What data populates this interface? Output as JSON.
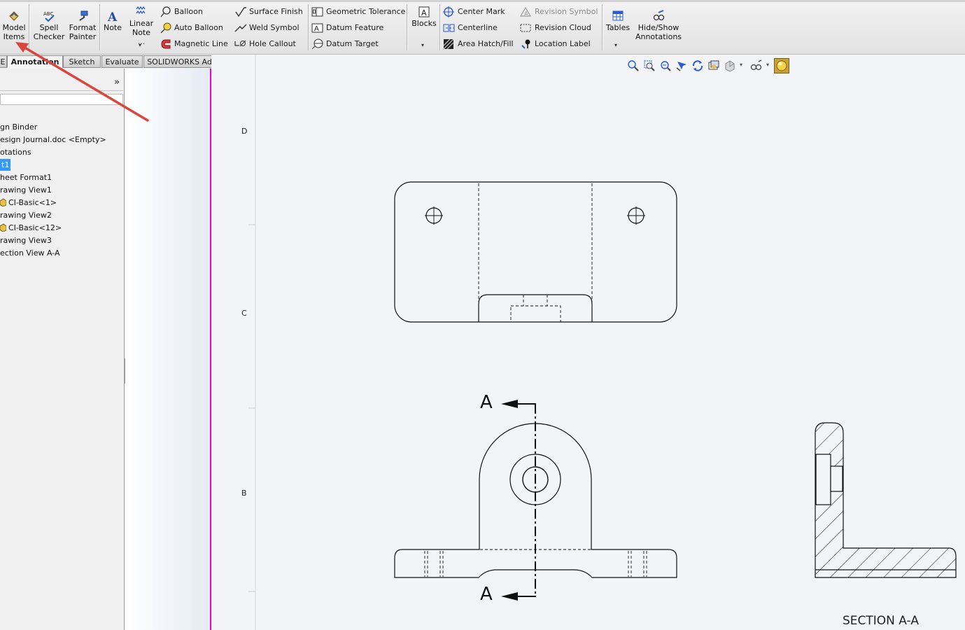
{
  "ribbon": {
    "large": {
      "model_items": "Model Items",
      "spell_checker": "Spell Checker",
      "format_painter": "Format Painter",
      "note": "Note",
      "linear_note": "Linear Note ...",
      "blocks": "Blocks",
      "tables": "Tables",
      "hide_show": "Hide/Show Annotations"
    },
    "col1": [
      "Balloon",
      "Auto Balloon",
      "Magnetic Line"
    ],
    "col2": [
      "Surface Finish",
      "Weld Symbol",
      "Hole Callout"
    ],
    "col3": [
      "Geometric Tolerance",
      "Datum Feature",
      "Datum Target"
    ],
    "col4": [
      "Center Mark",
      "Centerline",
      "Area Hatch/Fill"
    ],
    "col5": [
      "Revision Symbol",
      "Revision Cloud",
      "Location Label"
    ]
  },
  "tabs": [
    "E",
    "Annotation",
    "Sketch",
    "Evaluate",
    "SOLIDWORKS Add-Ins"
  ],
  "tree": [
    "gn Binder",
    "esign Journal.doc <Empty>",
    "otations",
    "t1",
    "heet Format1",
    "rawing View1",
    "CI-Basic<1>",
    "rawing View2",
    "CI-Basic<12>",
    "rawing View3",
    "ection View A-A"
  ],
  "drawing": {
    "zone_labels": [
      "D",
      "C",
      "B"
    ],
    "section_letter_top": "A",
    "section_letter_bottom": "A",
    "section_caption": "SECTION A-A"
  },
  "colors": {
    "accent": "#3399ff",
    "sheet_border": "#e400e4",
    "annotation_arrow": "#d9463c"
  }
}
